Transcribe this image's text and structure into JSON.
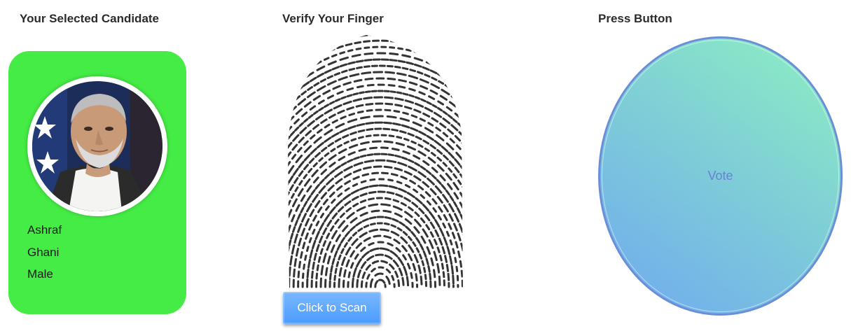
{
  "headings": {
    "candidate": "Your Selected Candidate",
    "finger": "Verify Your Finger",
    "press": "Press Button"
  },
  "candidate": {
    "first_name": "Ashraf",
    "last_name": "Ghani",
    "gender": "Male",
    "photo_icon": "candidate-portrait",
    "card_color": "#45ec45"
  },
  "scan": {
    "button_label": "Click to Scan",
    "fingerprint_icon": "fingerprint-image"
  },
  "vote": {
    "button_label": "Vote"
  }
}
